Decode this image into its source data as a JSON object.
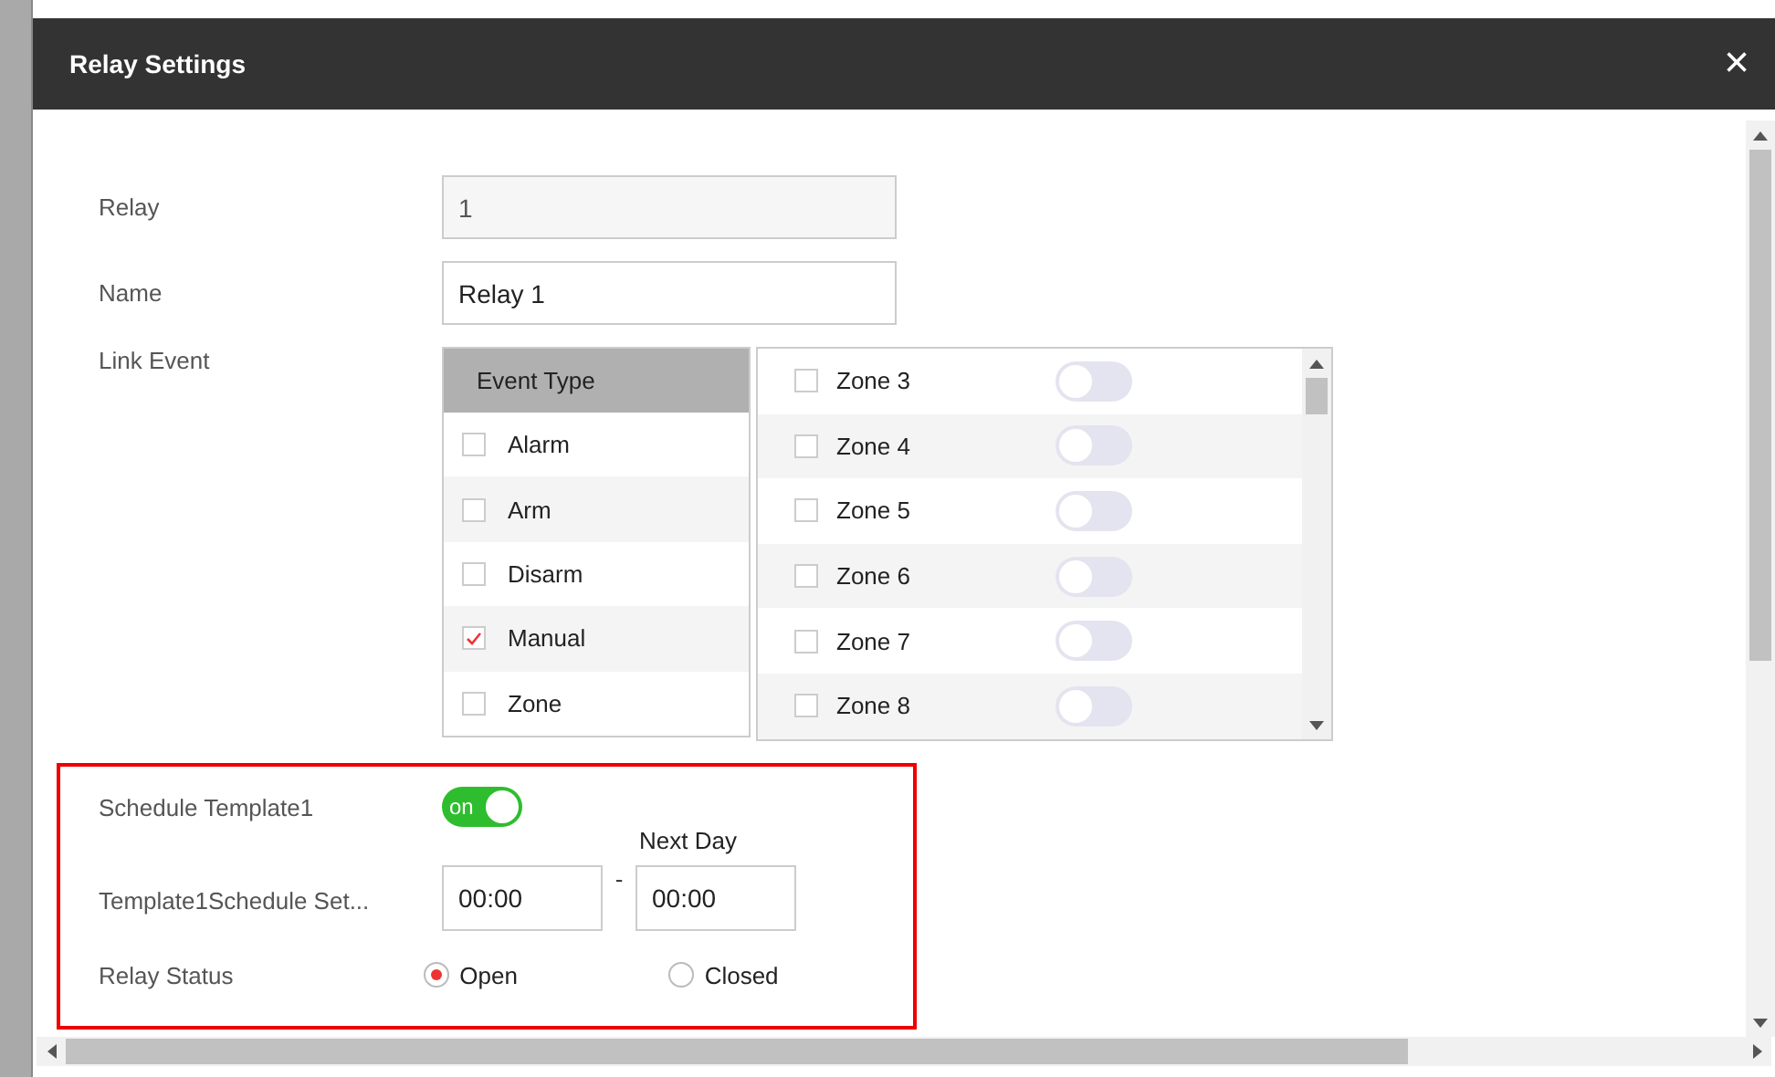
{
  "window": {
    "title": "Relay Settings",
    "close": "×"
  },
  "relay": {
    "label": "Relay",
    "value": "1",
    "disabled": true
  },
  "name": {
    "label": "Name",
    "value": "Relay 1"
  },
  "link_event": {
    "label": "Link Event",
    "header": "Event Type",
    "event_types": [
      {
        "label": "Alarm",
        "checked": false
      },
      {
        "label": "Arm",
        "checked": false
      },
      {
        "label": "Disarm",
        "checked": false
      },
      {
        "label": "Manual",
        "checked": true
      },
      {
        "label": "Zone",
        "checked": false
      }
    ],
    "zones": [
      {
        "label": "Zone 3",
        "checked": false,
        "on": false
      },
      {
        "label": "Zone 4",
        "checked": false,
        "on": false
      },
      {
        "label": "Zone 5",
        "checked": false,
        "on": false
      },
      {
        "label": "Zone 6",
        "checked": false,
        "on": false
      },
      {
        "label": "Zone 7",
        "checked": false,
        "on": false
      },
      {
        "label": "Zone 8",
        "checked": false,
        "on": false
      }
    ]
  },
  "schedule": {
    "label": "Schedule Template1",
    "on": true,
    "toggle_text": "on"
  },
  "schedule_set": {
    "label": "Template1Schedule Set...",
    "start": "00:00",
    "separator": "-",
    "end_caption": "Next Day",
    "end": "00:00"
  },
  "relay_status": {
    "label": "Relay Status",
    "options": [
      {
        "label": "Open",
        "selected": true
      },
      {
        "label": "Closed",
        "selected": false
      }
    ]
  }
}
